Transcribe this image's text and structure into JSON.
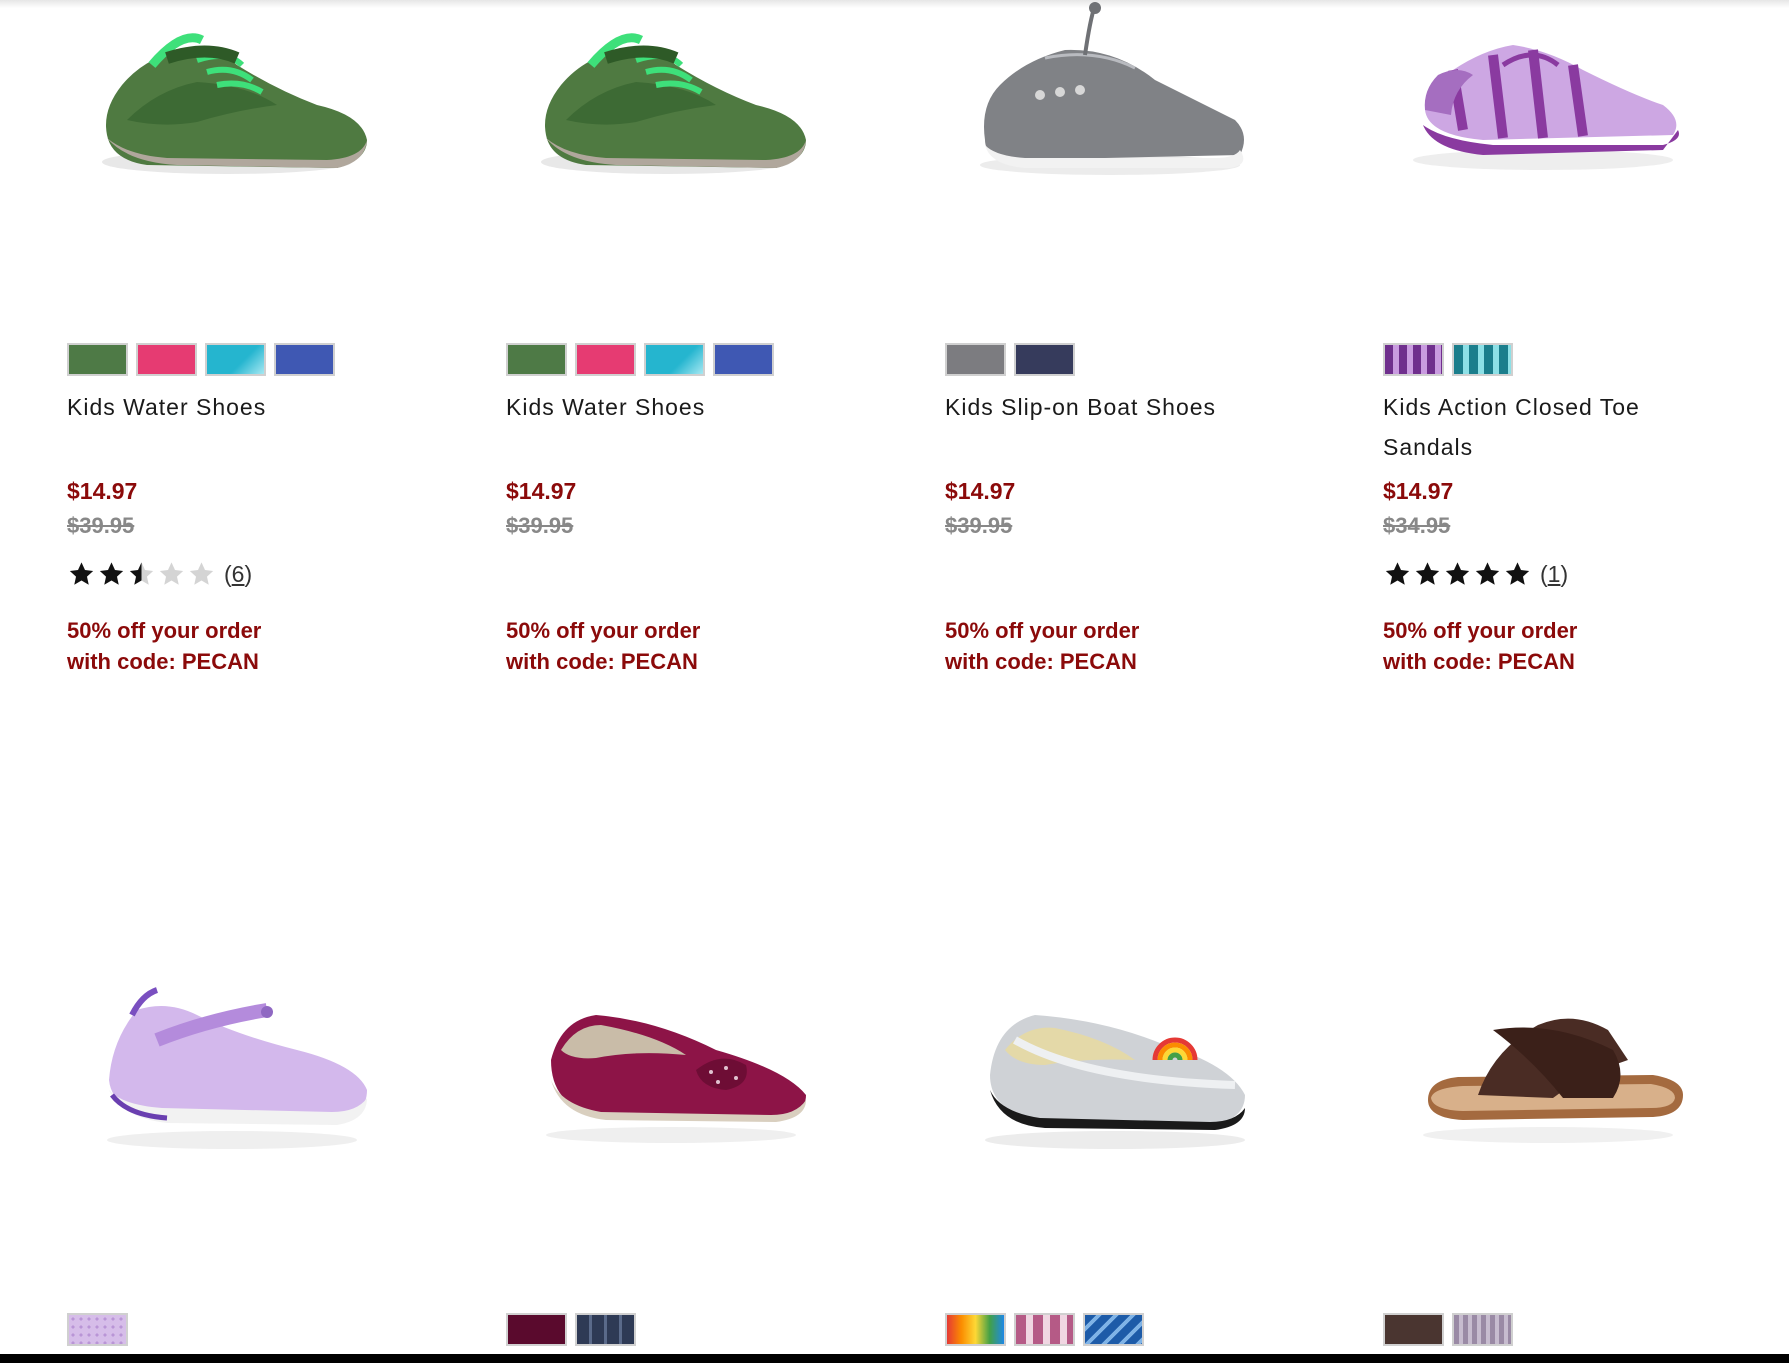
{
  "products": [
    {
      "name": "Kids Water Shoes",
      "price": "$14.97",
      "original_price": "$39.95",
      "rating": 2.5,
      "review_count": "6",
      "promo_line1": "50% off your order",
      "promo_line2": "with code: PECAN",
      "swatches": [
        "#4e7a46",
        "#e63b72",
        "#25b5cf",
        "#3f58b3"
      ],
      "image_icon": "green-water-shoe-image"
    },
    {
      "name": "Kids Water Shoes",
      "price": "$14.97",
      "original_price": "$39.95",
      "promo_line1": "50% off your order",
      "promo_line2": "with code: PECAN",
      "swatches": [
        "#4e7a46",
        "#e63b72",
        "#25b5cf",
        "#3f58b3"
      ],
      "image_icon": "green-water-shoe-image"
    },
    {
      "name": "Kids Slip-on Boat Shoes",
      "price": "$14.97",
      "original_price": "$39.95",
      "promo_line1": "50% off your order",
      "promo_line2": "with code: PECAN",
      "swatches": [
        "#7c7c80",
        "#363b5c"
      ],
      "image_icon": "grey-boat-shoe-image"
    },
    {
      "name": "Kids Action Closed Toe Sandals",
      "price": "$14.97",
      "original_price": "$34.95",
      "rating": 5,
      "review_count": "1",
      "promo_line1": "50% off your order",
      "promo_line2": "with code: PECAN",
      "swatches": [
        "#8b4fa5",
        "#2b9aa7"
      ],
      "image_icon": "purple-sandal-image"
    },
    {
      "swatches": [
        "#c9a2dc"
      ],
      "image_icon": "lavender-mary-jane-image"
    },
    {
      "swatches": [
        "#5a0a2d",
        "#2e3a55"
      ],
      "image_icon": "burgundy-velvet-flat-image"
    },
    {
      "swatches": [
        "#e7a84a",
        "#b55a86",
        "#1d5ba8"
      ],
      "image_icon": "silver-rainbow-loafer-image"
    },
    {
      "swatches": [
        "#4a3530",
        "#9a8aa5"
      ],
      "image_icon": "brown-slide-sandal-image"
    }
  ]
}
